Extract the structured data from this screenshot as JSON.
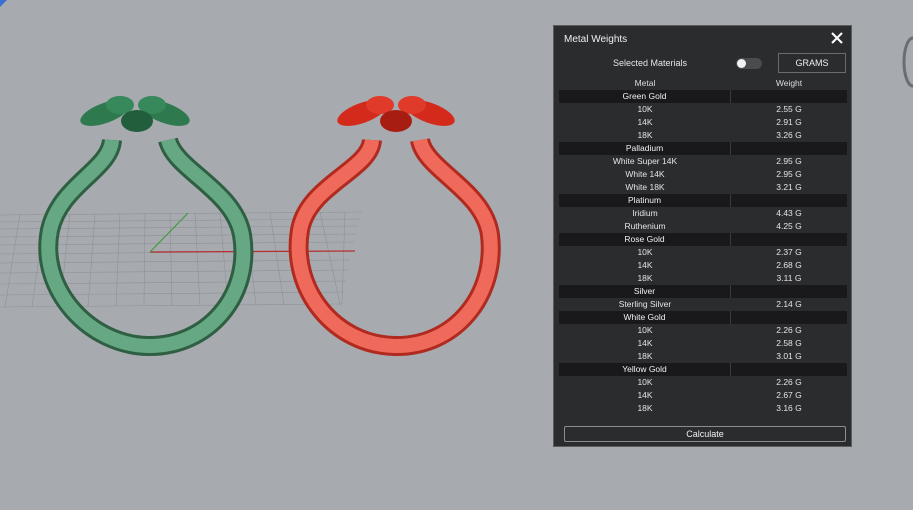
{
  "panel": {
    "title": "Metal Weights",
    "selected_materials_label": "Selected Materials",
    "selected_materials_toggle": false,
    "units_button_label": "GRAMS",
    "calculate_label": "Calculate"
  },
  "table": {
    "headers": [
      "Metal",
      "Weight"
    ],
    "groups": [
      {
        "name": "Green Gold",
        "items": [
          {
            "metal": "10K",
            "weight": "2.55 G"
          },
          {
            "metal": "14K",
            "weight": "2.91 G"
          },
          {
            "metal": "18K",
            "weight": "3.26 G"
          }
        ]
      },
      {
        "name": "Palladium",
        "items": [
          {
            "metal": "White Super 14K",
            "weight": "2.95 G"
          },
          {
            "metal": "White 14K",
            "weight": "2.95 G"
          },
          {
            "metal": "White 18K",
            "weight": "3.21 G"
          }
        ]
      },
      {
        "name": "Platinum",
        "items": [
          {
            "metal": "Iridium",
            "weight": "4.43 G"
          },
          {
            "metal": "Ruthenium",
            "weight": "4.25 G"
          }
        ]
      },
      {
        "name": "Rose Gold",
        "items": [
          {
            "metal": "10K",
            "weight": "2.37 G"
          },
          {
            "metal": "14K",
            "weight": "2.68 G"
          },
          {
            "metal": "18K",
            "weight": "3.11 G"
          }
        ]
      },
      {
        "name": "Silver",
        "items": [
          {
            "metal": "Sterling Silver",
            "weight": "2.14 G"
          }
        ]
      },
      {
        "name": "White Gold",
        "items": [
          {
            "metal": "10K",
            "weight": "2.26 G"
          },
          {
            "metal": "14K",
            "weight": "2.58 G"
          },
          {
            "metal": "18K",
            "weight": "3.01 G"
          }
        ]
      },
      {
        "name": "Yellow Gold",
        "items": [
          {
            "metal": "10K",
            "weight": "2.26 G"
          },
          {
            "metal": "14K",
            "weight": "2.67 G"
          },
          {
            "metal": "18K",
            "weight": "3.16 G"
          }
        ]
      }
    ]
  },
  "colors": {
    "viewport_bg": "#a7abb0",
    "green_ring": "#5fa07a",
    "green_flower": "#2e7a4e",
    "red_ring": "#f0574a",
    "red_flower": "#d42a1c"
  }
}
